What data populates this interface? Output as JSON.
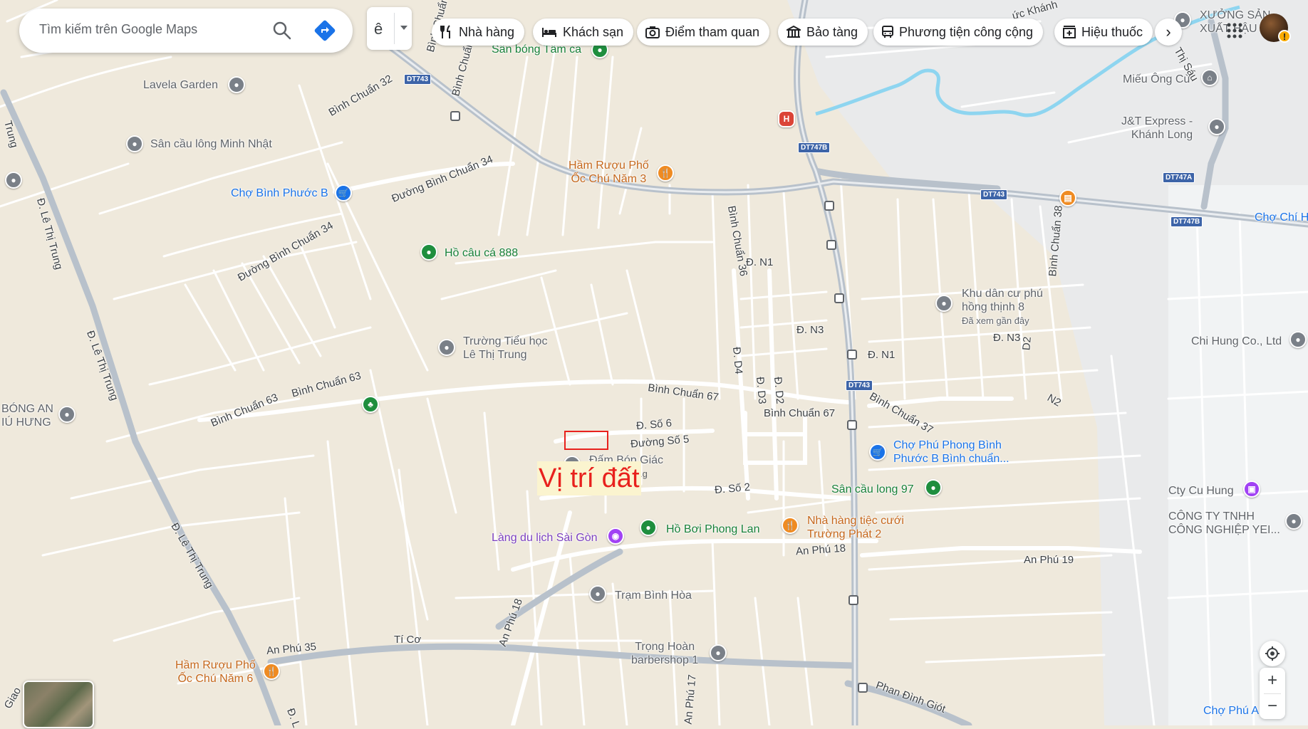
{
  "search": {
    "placeholder": "Tìm kiếm trên Google Maps"
  },
  "layer": {
    "label": "ê"
  },
  "chips": [
    {
      "label": "Nhà hàng",
      "icon": "fork-knife-icon"
    },
    {
      "label": "Khách sạn",
      "icon": "bed-icon"
    },
    {
      "label": "Điểm tham quan",
      "icon": "camera-icon"
    },
    {
      "label": "Bảo tàng",
      "icon": "museum-icon"
    },
    {
      "label": "Phương tiện công cộng",
      "icon": "bus-icon"
    },
    {
      "label": "Hiệu thuốc",
      "icon": "pharmacy-icon"
    }
  ],
  "chip_next": "›",
  "account": {
    "badge": "!"
  },
  "controls": {
    "zoom_in": "+",
    "zoom_out": "−"
  },
  "annotation": {
    "label": "Vị trí đất",
    "color": "#e8211d"
  },
  "shields": [
    "DT743",
    "DT747B",
    "DT743",
    "DT747A",
    "DT747B",
    "DT743"
  ],
  "roads": {
    "r1": "Bình Chuẩn 32",
    "r2": "Đường Bình Chuẩn 34",
    "r3": "Đường Bình Chuẩn 34",
    "r4": "Bình Chuẩn 63",
    "r5": "Bình Chuẩn 63",
    "r6": "Bình Chuẩn 67",
    "r7": "Bình Chuẩn 67",
    "r8": "Bình Chuẩn 36",
    "r9": "Bình Chuẩn 38",
    "r10": "Bình Chuẩn 37",
    "r11": "Đ. Số 6",
    "r12": "Đường Số 5",
    "r13": "Đ. Số 2",
    "r14": "Đ. N1",
    "r15": "Đ. N3",
    "r16": "Đ. N3",
    "r17": "Đ. N1",
    "r18": "Đ. D4",
    "r19": "Đ. D3",
    "r20": "Đ. D2",
    "r21": "D2",
    "r22": "N2",
    "r23": "An Phú 18",
    "r24": "An Phú 19",
    "r25": "An Phú 18",
    "r26": "An Phú 35",
    "r27": "Tí Cơ",
    "r28": "An Phú 17",
    "r29": "Phan Đình Giót",
    "r30": "Đ. Lê Thị Trung",
    "r31": "Đ. Lê Thị Trung",
    "r32": "Đ. Lê Thị Trung",
    "r33": "Thị Sáu",
    "r34": "Bình Chuẩn",
    "r35": "Bình Chuẩn 6",
    "r36": "Trung",
    "r37": "Giao",
    "r38": "Đ. L",
    "r39": "ức Khánh"
  },
  "pois": {
    "san_bong": "Sân bóng Tâm ca",
    "lavela": "Lavela Garden",
    "san_cau_long_mn": "Sân cầu lông Minh Nhật",
    "cho_bpb": "Chợ Bình Phước B",
    "ham_ruou_3": [
      "Hầm Rượu Phố",
      "Ốc Chú Năm 3"
    ],
    "ho_cau_ca": "Hồ câu cá 888",
    "truong_th": [
      "Trường Tiểu học",
      "Lê Thị Trung"
    ],
    "bong_an": [
      "BÓNG AN",
      "IÚ HƯNG"
    ],
    "dam_bop": "Đấm Bóp Giác",
    "dam_bop_sub": "Hơi...g",
    "lang_du_lich": "Làng du lịch Sài Gòn",
    "ho_boi": "Hồ Bơi Phong Lan",
    "nha_hang_tiec": [
      "Nhà hàng tiệc cưới",
      "Trường Phát 2"
    ],
    "san_cau_long_97": "Sân cầu long 97",
    "cho_phu_phong": [
      "Chợ Phú Phong Bình",
      "Phước B Bình chuẩn..."
    ],
    "tram_binh_hoa": "Trạm Bình Hòa",
    "trong_hoan": [
      "Trọng Hoàn",
      "barbershop 1"
    ],
    "ham_ruou_6": [
      "Hầm Rượu Phố",
      "Ốc Chú Năm 6"
    ],
    "khu_dan_cu": [
      "Khu dân cư phú",
      "hồng thịnh 8"
    ],
    "khu_dan_cu_sub": "Đã xem gần đây",
    "chi_hung": "Chi Hung Co., Ltd",
    "cty_cu_hung": "Cty Cu Hung",
    "cong_ty": [
      "CÔNG TY TNHH",
      "CÔNG NGHIỆP YEI..."
    ],
    "mieu_ong_cu": "Miếu Ông Cù",
    "jt_express": [
      "J&T Express -",
      "Khánh Long"
    ],
    "xuong_san": [
      "XƯỞNG SẢN",
      "XUẤT HẬU"
    ],
    "cho_chi_h": "Chợ Chí H",
    "cho_phu_an": "Chợ Phú An"
  }
}
